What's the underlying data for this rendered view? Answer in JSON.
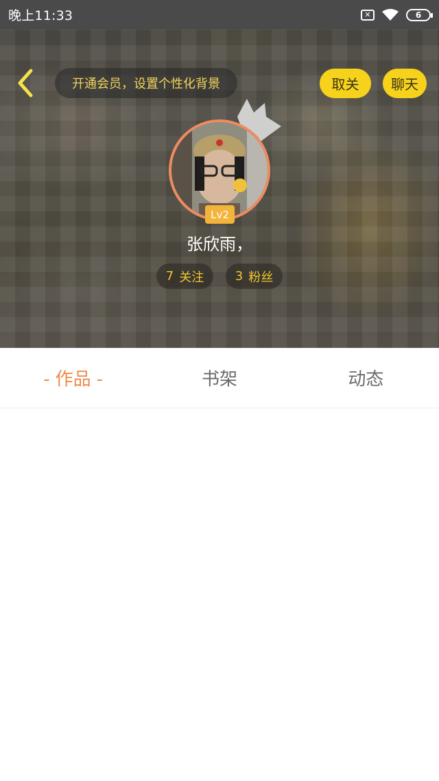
{
  "status_bar": {
    "time": "晚上11:33",
    "battery": "6",
    "icons": [
      "sim-off-icon",
      "wifi-icon",
      "battery-icon"
    ]
  },
  "header": {
    "back_icon": "chevron-left-icon",
    "vip_text": "开通会员，设置个性化背景",
    "unfollow_label": "取关",
    "chat_label": "聊天",
    "accent_color": "#f7d21c"
  },
  "profile": {
    "level": "Lv2",
    "username": "张欣雨，",
    "following_count": "7",
    "following_label": "关注",
    "fans_count": "3",
    "fans_label": "粉丝"
  },
  "tabs": [
    {
      "label": "作品",
      "active": true
    },
    {
      "label": "书架",
      "active": false
    },
    {
      "label": "动态",
      "active": false
    }
  ],
  "tab_dash": "-",
  "active_tab_color": "#f08a4b"
}
